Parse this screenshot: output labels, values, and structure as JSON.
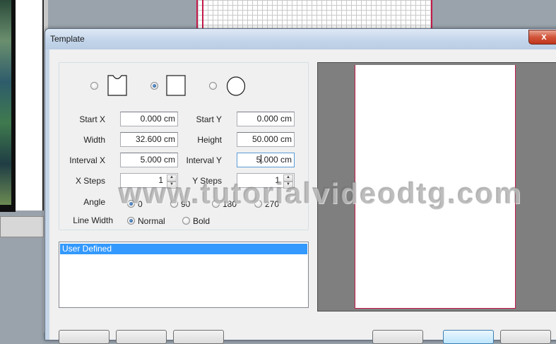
{
  "dialog": {
    "title": "Template",
    "close_label": "x"
  },
  "form": {
    "start_x": {
      "label": "Start X",
      "value": "0.000 cm"
    },
    "start_y": {
      "label": "Start Y",
      "value": "0.000 cm"
    },
    "width": {
      "label": "Width",
      "value": "32.600 cm"
    },
    "height": {
      "label": "Height",
      "value": "50.000 cm"
    },
    "interval_x": {
      "label": "Interval X",
      "value": "5.000 cm"
    },
    "interval_y": {
      "label": "Interval Y",
      "value_before_caret": "5",
      "value_after_caret": ".000 cm"
    },
    "x_steps": {
      "label": "X Steps",
      "value": "1"
    },
    "y_steps": {
      "label": "Y Steps",
      "value": "1"
    }
  },
  "shapes": {
    "options": [
      "notched-rectangle",
      "rectangle",
      "circle"
    ],
    "selected": "rectangle"
  },
  "angle": {
    "label": "Angle",
    "options": [
      "0",
      "90",
      "180",
      "270"
    ],
    "selected": "0"
  },
  "line_width": {
    "label": "Line Width",
    "options": [
      "Normal",
      "Bold"
    ],
    "selected": "Normal"
  },
  "list": {
    "items": [
      "User Defined"
    ],
    "selected": "User Defined"
  },
  "watermark": "www.tutorialvideodtg.com",
  "colors": {
    "selection": "#3399ff",
    "preview_background": "#7f7f7f",
    "page_border": "#c41a4a"
  }
}
